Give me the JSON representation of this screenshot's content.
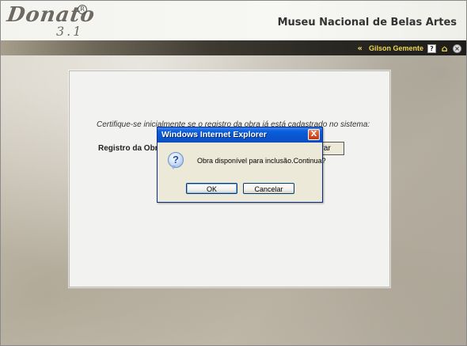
{
  "header": {
    "logo_text": "Donato",
    "logo_version": "3.1",
    "logo_reg": "R",
    "site_title": "Museu Nacional de Belas Artes"
  },
  "navbar": {
    "chevron": "«",
    "user_name": "Gilson Gemente",
    "help_icon": "?",
    "home_icon": "⌂",
    "close_icon": "×"
  },
  "panel": {
    "instruction": "Certifique-se inicialmente se o registro da obra já está cadastrado no sistema:",
    "field_label": "Registro da Obra",
    "search_button": "urar"
  },
  "dialog": {
    "title": "Windows Internet Explorer",
    "close": "X",
    "icon": "?",
    "message": "Obra disponível para inclusão.Continua?",
    "ok_label": "OK",
    "cancel_label": "Cancelar"
  },
  "colors": {
    "titlebar": "#0856d3",
    "user_name": "#f0d850",
    "close_button": "#d24b22"
  }
}
